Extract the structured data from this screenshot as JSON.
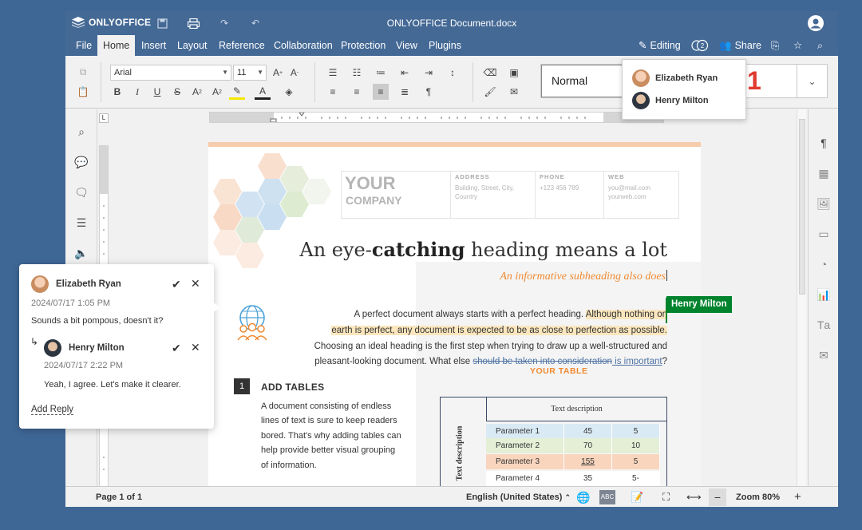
{
  "app": {
    "logo": "ONLYOFFICE",
    "document_title": "ONLYOFFICE Document.docx"
  },
  "menu": {
    "tabs": [
      "File",
      "Home",
      "Insert",
      "Layout",
      "Reference",
      "Collaboration",
      "Protection",
      "View",
      "Plugins"
    ],
    "active_tab": "Home",
    "editing_label": "Editing",
    "users_count": "2",
    "share_label": "Share"
  },
  "toolbar": {
    "font_name": "Arial",
    "font_size": "11",
    "style_normal": "Normal",
    "style_heading_preview": "1"
  },
  "users_popup": {
    "users": [
      "Elizabeth Ryan",
      "Henry Milton"
    ]
  },
  "document": {
    "company_your": "YOUR",
    "company_name": "COMPANY",
    "address_label": "ADDRESS",
    "address_text": "Building, Street, City, Country",
    "phone_label": "PHONE",
    "phone_text": "+123 456 789",
    "web_label": "WEB",
    "web_line1": "you@mail.com",
    "web_line2": "yourweb.com",
    "heading_a": "An eye-",
    "heading_b": "catching",
    "heading_c": " heading means a lot",
    "subheading": "An informative subheading also does",
    "para1_a": "A perfect document always starts with a perfect heading. ",
    "para1_b": "Although nothing on",
    "para2": "earth is perfect, any document is expected to be as close to perfection as possible.",
    "para3": "Choosing an ideal heading is the first step when trying to draw up a well-structured and",
    "para4_a": "pleasant-looking document. What else ",
    "para4_struck": "should be taken into consideration",
    "para4_ins": " is important",
    "para4_end": "?",
    "section_number": "1",
    "section_title": "ADD TABLES",
    "section_body": "A document consisting of endless lines of text is sure to keep readers bored. That's why adding tables can help provide better visual grouping of information.",
    "table_title": "YOUR TABLE",
    "table_description": "Text description",
    "table_vertical_label": "Text description",
    "table_rows": [
      {
        "name": "Parameter 1",
        "a": "45",
        "b": "5"
      },
      {
        "name": "Parameter 2",
        "a": "70",
        "b": "10"
      },
      {
        "name": "Parameter 3",
        "a": "155",
        "b": "5"
      },
      {
        "name": "Parameter 4",
        "a": "35",
        "b": "5-"
      }
    ],
    "table_row_colors": [
      "#d9eaf4",
      "#e4efd6",
      "#f9d5bd",
      "#ffffff"
    ]
  },
  "collab_cursor": {
    "user": "Henry Milton",
    "color": "#00832d"
  },
  "comments": {
    "author": "Elizabeth Ryan",
    "date": "2024/07/17 1:05 PM",
    "text": "Sounds a bit pompous, doesn't it?",
    "reply_author": "Henry Milton",
    "reply_date": "2024/07/17 2:22 PM",
    "reply_text": "Yeah, I agree. Let's make it clearer.",
    "add_reply": "Add Reply"
  },
  "statusbar": {
    "page": "Page 1 of 1",
    "language": "English (United States)",
    "zoom": "Zoom 80%"
  },
  "colors": {
    "brand": "#446995",
    "background": "#3f6796",
    "accent_orange": "#f08a30"
  }
}
